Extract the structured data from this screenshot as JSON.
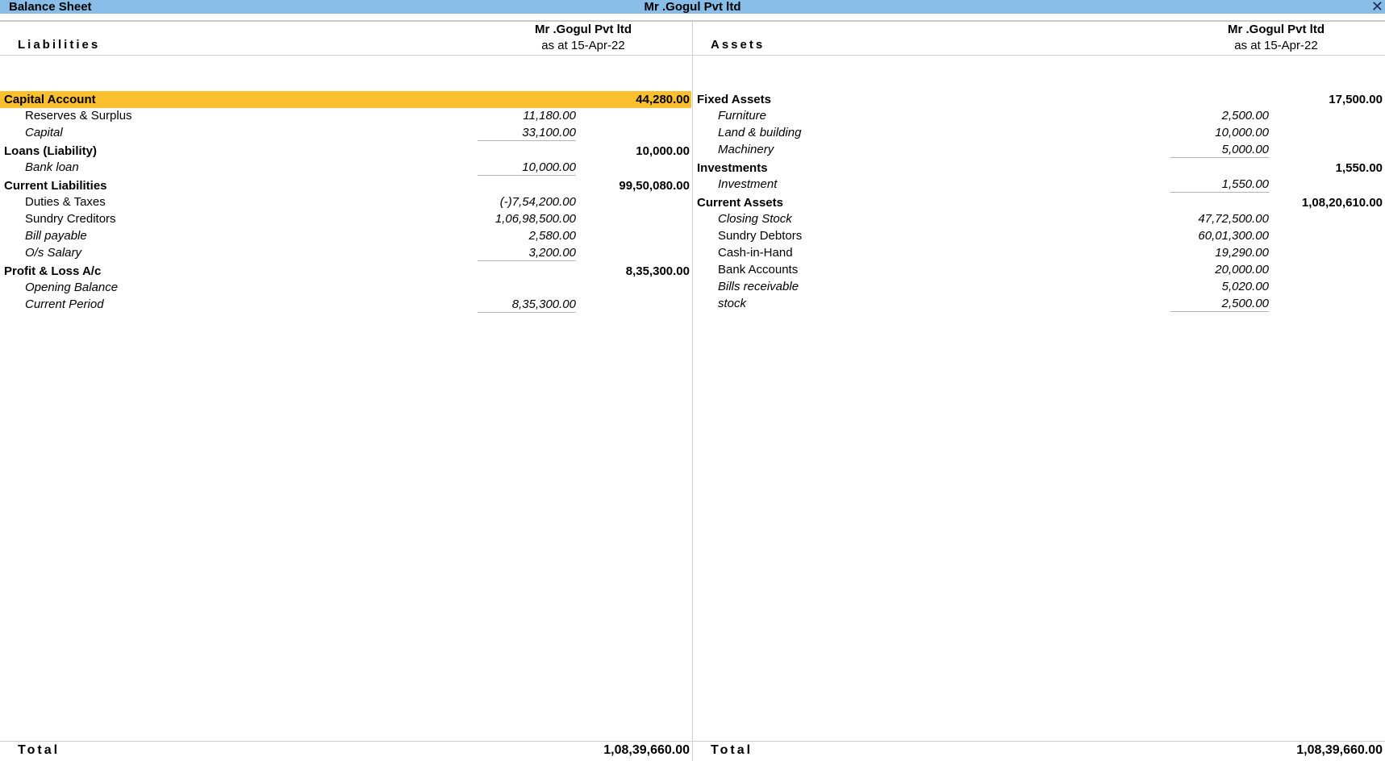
{
  "window": {
    "title": "Balance Sheet",
    "company_title": "Mr .Gogul Pvt ltd",
    "close_icon": "close-icon"
  },
  "liabilities": {
    "side_title": "Liabilities",
    "company": "Mr .Gogul Pvt ltd",
    "as_at": "as at 15-Apr-22",
    "groups": [
      {
        "name": "Capital Account",
        "amount": "44,280.00",
        "highlighted": true,
        "items": [
          {
            "name": "Reserves & Surplus",
            "amount": "11,180.00",
            "italic": false
          },
          {
            "name": "Capital",
            "amount": "33,100.00",
            "italic": true
          }
        ]
      },
      {
        "name": "Loans (Liability)",
        "amount": "10,000.00",
        "items": [
          {
            "name": "Bank loan",
            "amount": "10,000.00",
            "italic": true
          }
        ]
      },
      {
        "name": "Current Liabilities",
        "amount": "99,50,080.00",
        "items": [
          {
            "name": "Duties & Taxes",
            "amount": "(-)7,54,200.00",
            "italic": false
          },
          {
            "name": "Sundry Creditors",
            "amount": "1,06,98,500.00",
            "italic": false
          },
          {
            "name": "Bill payable",
            "amount": "2,580.00",
            "italic": true
          },
          {
            "name": "O/s Salary",
            "amount": "3,200.00",
            "italic": true
          }
        ]
      },
      {
        "name": "Profit & Loss A/c",
        "amount": "8,35,300.00",
        "items": [
          {
            "name": "Opening Balance",
            "amount": "",
            "italic": true
          },
          {
            "name": "Current Period",
            "amount": "8,35,300.00",
            "italic": true
          }
        ]
      }
    ],
    "total_label": "Total",
    "total": "1,08,39,660.00"
  },
  "assets": {
    "side_title": "Assets",
    "company": "Mr .Gogul Pvt ltd",
    "as_at": "as at 15-Apr-22",
    "groups": [
      {
        "name": "Fixed Assets",
        "amount": "17,500.00",
        "items": [
          {
            "name": "Furniture",
            "amount": "2,500.00",
            "italic": true
          },
          {
            "name": "Land & building",
            "amount": "10,000.00",
            "italic": true
          },
          {
            "name": "Machinery",
            "amount": "5,000.00",
            "italic": true
          }
        ]
      },
      {
        "name": "Investments",
        "amount": "1,550.00",
        "items": [
          {
            "name": "Investment",
            "amount": "1,550.00",
            "italic": true
          }
        ]
      },
      {
        "name": "Current Assets",
        "amount": "1,08,20,610.00",
        "items": [
          {
            "name": "Closing Stock",
            "amount": "47,72,500.00",
            "italic": true
          },
          {
            "name": "Sundry Debtors",
            "amount": "60,01,300.00",
            "italic": false
          },
          {
            "name": "Cash-in-Hand",
            "amount": "19,290.00",
            "italic": false
          },
          {
            "name": "Bank Accounts",
            "amount": "20,000.00",
            "italic": false
          },
          {
            "name": "Bills receivable",
            "amount": "5,020.00",
            "italic": true
          },
          {
            "name": "stock",
            "amount": "2,500.00",
            "italic": true
          }
        ]
      }
    ],
    "total_label": "Total",
    "total": "1,08,39,660.00"
  },
  "colors": {
    "titlebar": "#87bde6",
    "highlight": "#fbc02d"
  }
}
